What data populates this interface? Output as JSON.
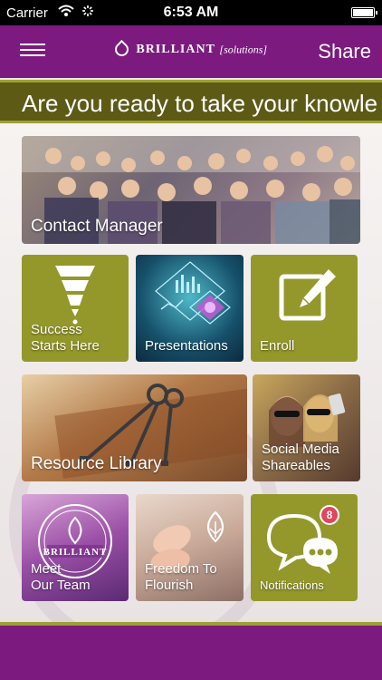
{
  "status": {
    "carrier": "Carrier",
    "time": "6:53 AM"
  },
  "header": {
    "brand": "BRILLIANT",
    "brand_sub": "[solutions]",
    "share_label": "Share"
  },
  "marquee": {
    "text": "Are you ready to take your knowle"
  },
  "tiles": {
    "contact_manager": "Contact Manager",
    "success_line1": "Success",
    "success_line2": "Starts Here",
    "presentations": "Presentations",
    "enroll": "Enroll",
    "resource_library": "Resource Library",
    "social_line1": "Social Media",
    "social_line2": "Shareables",
    "team_line1": "Meet",
    "team_line2": "Our Team",
    "team_logo": "BRILLIANT",
    "freedom_line1": "Freedom To",
    "freedom_line2": "Flourish",
    "notifications": "Notifications",
    "notification_count": "8"
  },
  "colors": {
    "purple": "#7c1a80",
    "olive": "#94982b",
    "badge": "#e2455c"
  },
  "icons": [
    "wifi-icon",
    "activity-icon",
    "battery-icon",
    "menu-icon",
    "funnel-icon",
    "edit-icon",
    "chat-icon",
    "keys-icon"
  ]
}
